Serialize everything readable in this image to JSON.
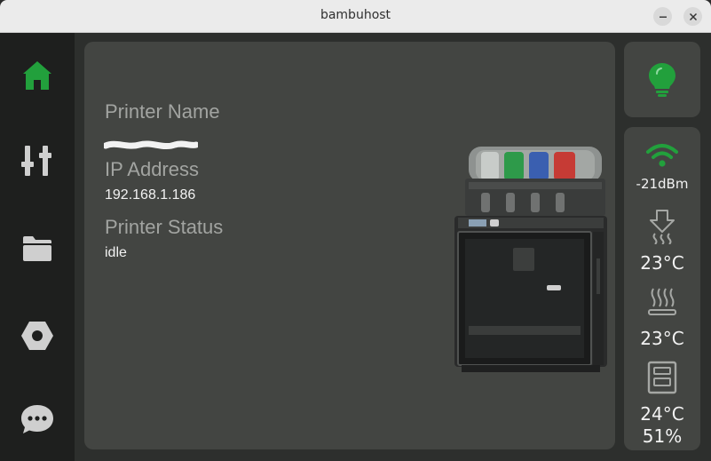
{
  "window": {
    "title": "bambuhost"
  },
  "sidebar": {
    "items": [
      {
        "name": "home",
        "icon": "home-icon",
        "active": true
      },
      {
        "name": "controls",
        "icon": "sliders-icon",
        "active": false
      },
      {
        "name": "files",
        "icon": "folder-icon",
        "active": false
      },
      {
        "name": "filament",
        "icon": "hexagon-nut-icon",
        "active": false
      },
      {
        "name": "messages",
        "icon": "chat-bubble-icon",
        "active": false
      }
    ]
  },
  "printer_info": {
    "name_label": "Printer Name",
    "ip_label": "IP Address",
    "ip_value": "192.168.1.186",
    "status_label": "Printer Status",
    "status_value": "idle"
  },
  "light": {
    "icon": "lightbulb-icon",
    "on": true
  },
  "stats": {
    "wifi": {
      "icon": "wifi-icon",
      "value": "-21dBm"
    },
    "nozzle": {
      "icon": "nozzle-heat-icon",
      "value": "23°C"
    },
    "bed": {
      "icon": "heatbed-icon",
      "value": "23°C"
    },
    "chamber": {
      "icon": "chamber-icon",
      "temp": "24°C",
      "humidity": "51%"
    }
  },
  "colors": {
    "accent": "#22a03c",
    "icon_inactive": "#cfcfcf",
    "card": "#434542",
    "sidebar": "#1e1f1e"
  }
}
